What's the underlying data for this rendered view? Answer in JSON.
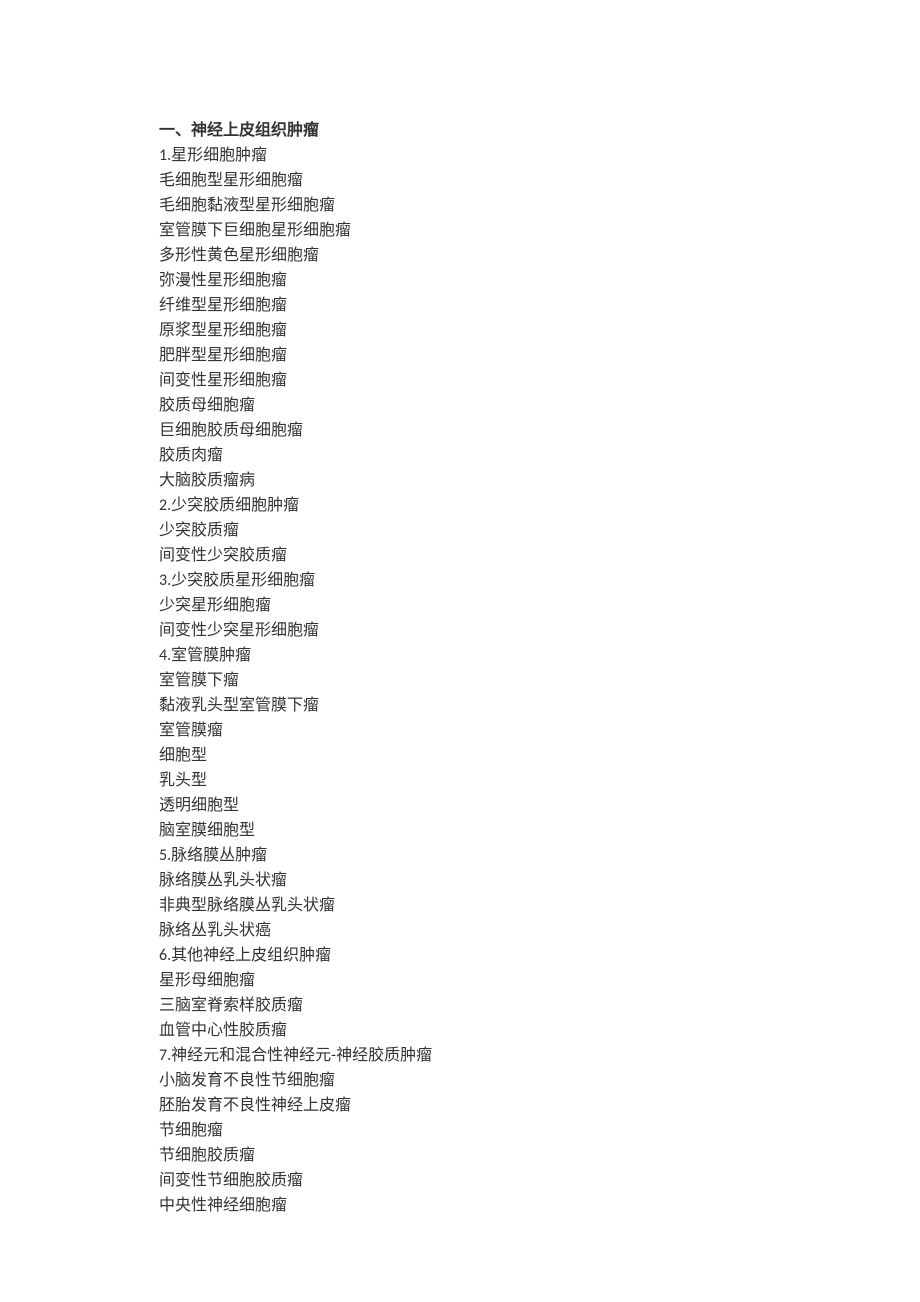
{
  "heading": "一、神经上皮组织肿瘤",
  "sections": [
    {
      "number": "1.",
      "title": "星形细胞肿瘤",
      "items": [
        "毛细胞型星形细胞瘤",
        "毛细胞黏液型星形细胞瘤",
        "室管膜下巨细胞星形细胞瘤",
        "多形性黄色星形细胞瘤",
        "弥漫性星形细胞瘤",
        "纤维型星形细胞瘤",
        "原浆型星形细胞瘤",
        "肥胖型星形细胞瘤",
        "间变性星形细胞瘤",
        "胶质母细胞瘤",
        "巨细胞胶质母细胞瘤",
        "胶质肉瘤",
        "大脑胶质瘤病"
      ]
    },
    {
      "number": "2.",
      "title": "少突胶质细胞肿瘤",
      "items": [
        "少突胶质瘤",
        "间变性少突胶质瘤"
      ]
    },
    {
      "number": "3.",
      "title": "少突胶质星形细胞瘤",
      "items": [
        "少突星形细胞瘤",
        "间变性少突星形细胞瘤"
      ]
    },
    {
      "number": "4.",
      "title": "室管膜肿瘤",
      "items": [
        "室管膜下瘤",
        "黏液乳头型室管膜下瘤",
        "室管膜瘤",
        "细胞型",
        "乳头型",
        "透明细胞型",
        "脑室膜细胞型"
      ]
    },
    {
      "number": "5.",
      "title": "脉络膜丛肿瘤",
      "items": [
        "脉络膜丛乳头状瘤",
        "非典型脉络膜丛乳头状瘤",
        "脉络丛乳头状癌"
      ]
    },
    {
      "number": "6.",
      "title": "其他神经上皮组织肿瘤",
      "items": [
        "星形母细胞瘤",
        "三脑室脊索样胶质瘤",
        "血管中心性胶质瘤"
      ]
    },
    {
      "number": "7.",
      "title_pre": "神经元和混合性神经元",
      "title_sep": "-",
      "title_post": "神经胶质肿瘤",
      "items": [
        "小脑发育不良性节细胞瘤",
        "胚胎发育不良性神经上皮瘤",
        "节细胞瘤",
        "节细胞胶质瘤",
        "间变性节细胞胶质瘤",
        "中央性神经细胞瘤"
      ]
    }
  ]
}
